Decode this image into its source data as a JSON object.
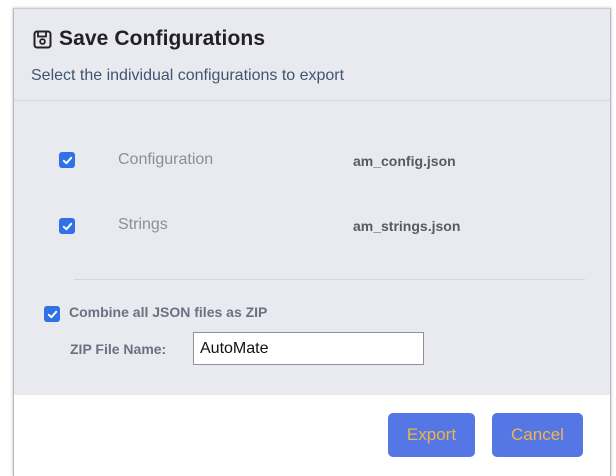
{
  "dialog": {
    "title": "Save Configurations",
    "title_icon": "save-icon",
    "subtitle": "Select the individual configurations to export"
  },
  "items": [
    {
      "label": "Configuration",
      "file": "am_config.json",
      "checked": true
    },
    {
      "label": "Strings",
      "file": "am_strings.json",
      "checked": true
    }
  ],
  "zip": {
    "combine_label": "Combine all JSON files as ZIP",
    "combine_checked": true,
    "name_label": "ZIP File Name:",
    "name_value": "AutoMate"
  },
  "buttons": {
    "export": "Export",
    "cancel": "Cancel"
  },
  "colors": {
    "checkbox": "#2f72e8",
    "button_bg": "#5577e6",
    "button_text": "#f2b544",
    "dialog_bg": "#e9eaf0"
  }
}
